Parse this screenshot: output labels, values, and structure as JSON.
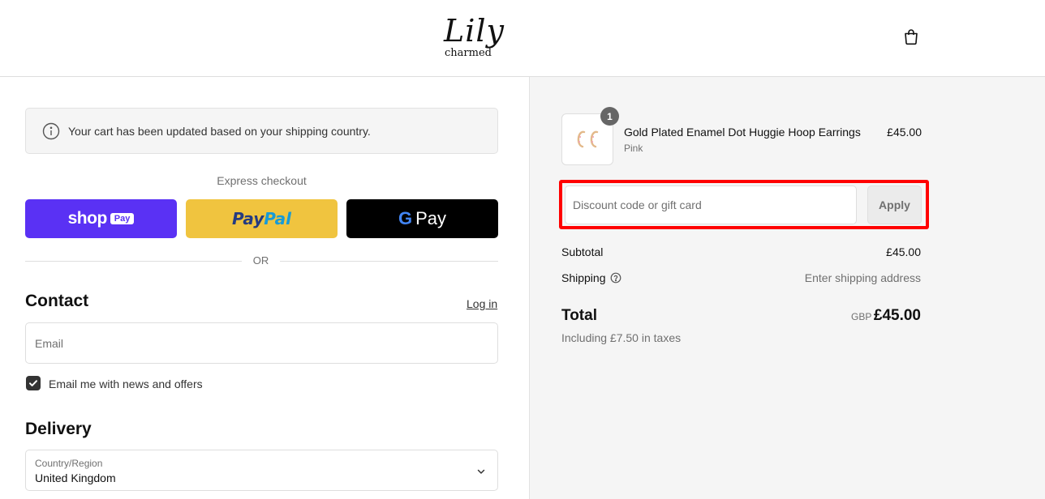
{
  "header": {
    "logo_script": "Lily",
    "logo_sub": "charmed",
    "cart_icon": "shopping-bag-icon"
  },
  "notice": {
    "icon": "info-icon",
    "text": "Your cart has been updated based on your shipping country."
  },
  "express": {
    "label": "Express checkout",
    "shop_pay": {
      "word": "shop",
      "badge": "Pay",
      "color": "#5a31f4"
    },
    "paypal": {
      "part1": "Pay",
      "part2": "Pal",
      "color": "#f0c43f"
    },
    "gpay": {
      "g": "G",
      "word": "Pay",
      "color": "#000000"
    },
    "or_text": "OR"
  },
  "contact": {
    "title": "Contact",
    "login_label": "Log in",
    "email_placeholder": "Email",
    "newsletter_label": "Email me with news and offers",
    "newsletter_checked": true
  },
  "delivery": {
    "title": "Delivery",
    "country_label": "Country/Region",
    "country_value": "United Kingdom"
  },
  "summary": {
    "item": {
      "name": "Gold Plated Enamel Dot Huggie Hoop Earrings",
      "variant": "Pink",
      "price": "£45.00",
      "quantity": "1"
    },
    "discount_placeholder": "Discount code or gift card",
    "apply_label": "Apply",
    "subtotal_label": "Subtotal",
    "subtotal_value": "£45.00",
    "shipping_label": "Shipping",
    "shipping_value": "Enter shipping address",
    "total_label": "Total",
    "total_currency": "GBP",
    "total_value": "£45.00",
    "tax_note": "Including £7.50 in taxes"
  },
  "colors": {
    "highlight": "#ff0000",
    "summary_bg": "#f5f5f5"
  }
}
